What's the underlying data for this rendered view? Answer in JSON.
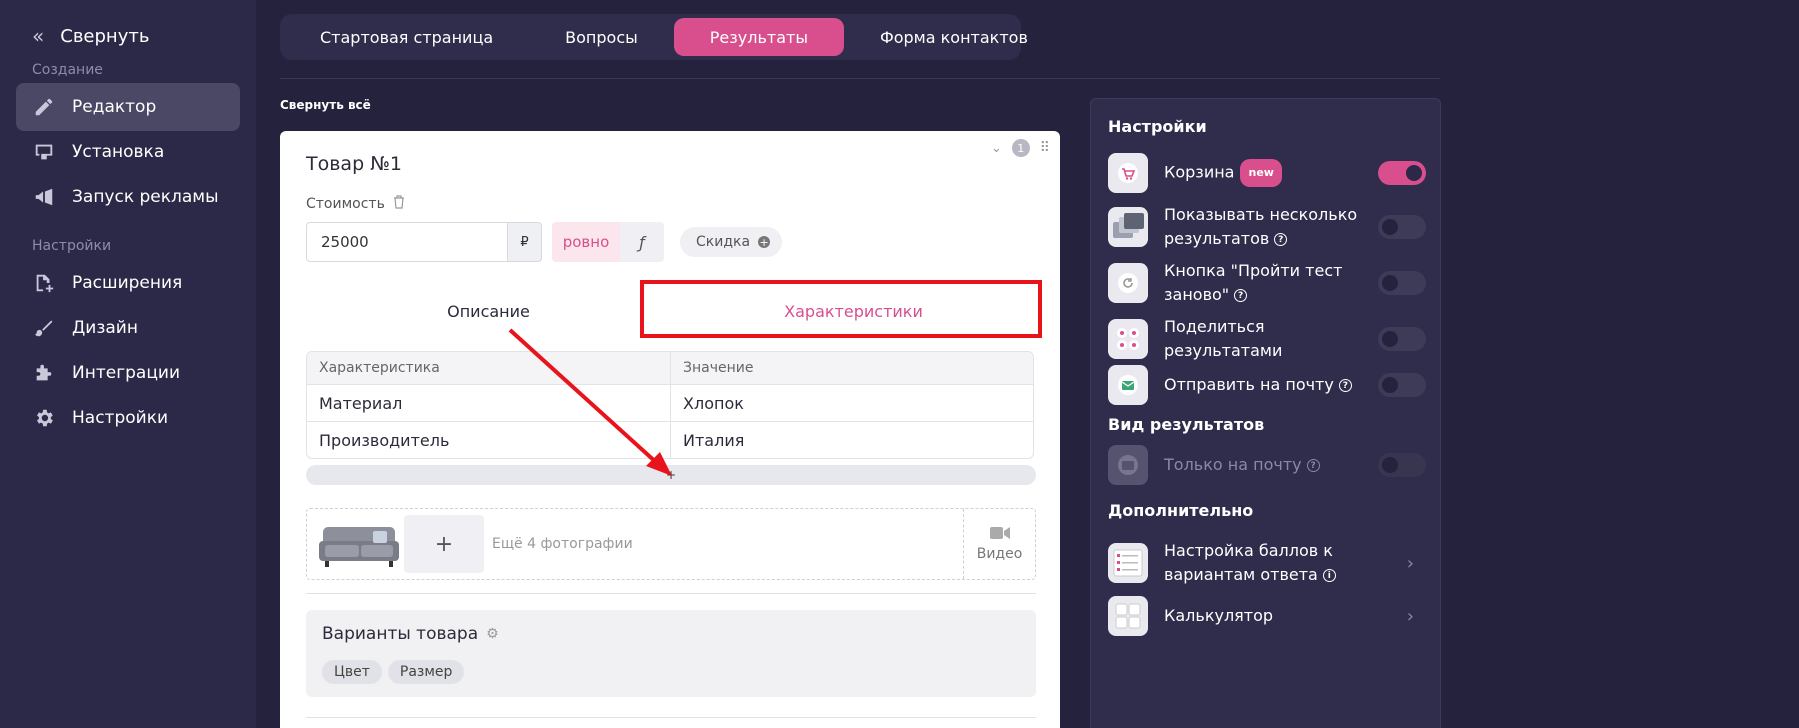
{
  "sidebar": {
    "collapse_label": "Свернуть",
    "section_create": "Создание",
    "section_settings": "Настройки",
    "items": [
      {
        "label": "Редактор",
        "icon": "pencil-icon"
      },
      {
        "label": "Установка",
        "icon": "install-icon"
      },
      {
        "label": "Запуск рекламы",
        "icon": "megaphone-icon"
      },
      {
        "label": "Расширения",
        "icon": "extensions-icon"
      },
      {
        "label": "Дизайн",
        "icon": "brush-icon"
      },
      {
        "label": "Интеграции",
        "icon": "puzzle-icon"
      },
      {
        "label": "Настройки",
        "icon": "gear-icon"
      }
    ]
  },
  "tabs": [
    {
      "label": "Стартовая страница"
    },
    {
      "label": "Вопросы"
    },
    {
      "label": "Результаты",
      "active": true
    },
    {
      "label": "Форма контактов"
    }
  ],
  "collapse_all": "Свернуть всё",
  "product": {
    "title": "Товар №1",
    "number": "1",
    "price_label": "Стоимость",
    "price_value": "25000",
    "currency": "₽",
    "exact_label": "ровно",
    "func_label": "ƒ",
    "discount_label": "Скидка",
    "subtabs": [
      "Описание",
      "Характеристики"
    ],
    "table": {
      "headers": [
        "Характеристика",
        "Значение"
      ],
      "rows": [
        [
          "Материал",
          "Хлопок"
        ],
        [
          "Производитель",
          "Италия"
        ]
      ]
    },
    "add_row_label": "+",
    "add_photo_label": "+",
    "more_photos": "Ещё 4 фотографии",
    "video_label": "Видео",
    "variants_title": "Варианты товара",
    "variant_chips": [
      "Цвет",
      "Размер"
    ]
  },
  "settings": {
    "header": "Настройки",
    "view_header": "Вид результатов",
    "extra_header": "Дополнительно",
    "new_badge": "new",
    "qm": "?",
    "info": "i",
    "items": [
      {
        "label": "Корзина",
        "toggle": true
      },
      {
        "label": "Показывать несколько результатов",
        "toggle": false
      },
      {
        "label": "Кнопка \"Пройти тест заново\"",
        "toggle": false
      },
      {
        "label": "Поделиться результатами",
        "toggle": false
      },
      {
        "label": "Отправить на почту",
        "toggle": false
      }
    ],
    "view_items": [
      {
        "label": "Только на почту",
        "toggle": false,
        "disabled": true
      }
    ],
    "extra_items": [
      {
        "label": "Настройка баллов к вариантам ответа"
      },
      {
        "label": "Калькулятор"
      }
    ]
  },
  "colors": {
    "accent": "#d94f8d",
    "background": "#24223d",
    "sidebar": "#2b2947",
    "annotation": "#e8131b"
  }
}
